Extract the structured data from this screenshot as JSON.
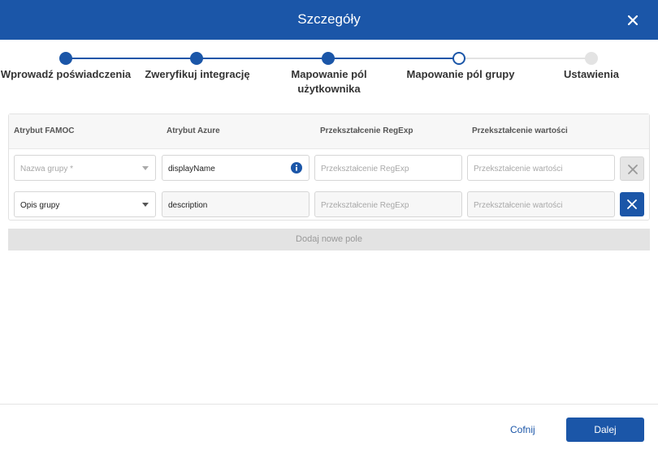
{
  "dialog": {
    "title": "Szczegóły",
    "close_icon": "close-icon"
  },
  "stepper": {
    "steps": [
      {
        "label": "Wprowadź poświadczenia",
        "state": "done"
      },
      {
        "label": "Zweryfikuj integrację",
        "state": "done"
      },
      {
        "label_line1": "Mapowanie pól",
        "label_line2": "użytkownika",
        "state": "done"
      },
      {
        "label": "Mapowanie pól grupy",
        "state": "current"
      },
      {
        "label": "Ustawienia",
        "state": "future"
      }
    ]
  },
  "table": {
    "headers": [
      "Atrybut FAMOC",
      "Atrybut Azure",
      "Przekształcenie RegExp",
      "Przekształcenie wartości"
    ],
    "rows": [
      {
        "famoc_placeholder": "Nazwa grupy *",
        "azure_value": "displayName",
        "regexp_placeholder": "Przekształcenie RegExp",
        "value_placeholder": "Przekształcenie wartości",
        "removable": false
      },
      {
        "famoc_value": "Opis grupy",
        "azure_value": "description",
        "regexp_placeholder": "Przekształcenie RegExp",
        "value_placeholder": "Przekształcenie wartości",
        "removable": true
      }
    ]
  },
  "add_field_label": "Dodaj nowe pole",
  "footer": {
    "back_label": "Cofnij",
    "next_label": "Dalej"
  },
  "colors": {
    "primary": "#1b56a8",
    "future_step": "#e3e3e3",
    "header_bg": "#f7f7f7"
  }
}
